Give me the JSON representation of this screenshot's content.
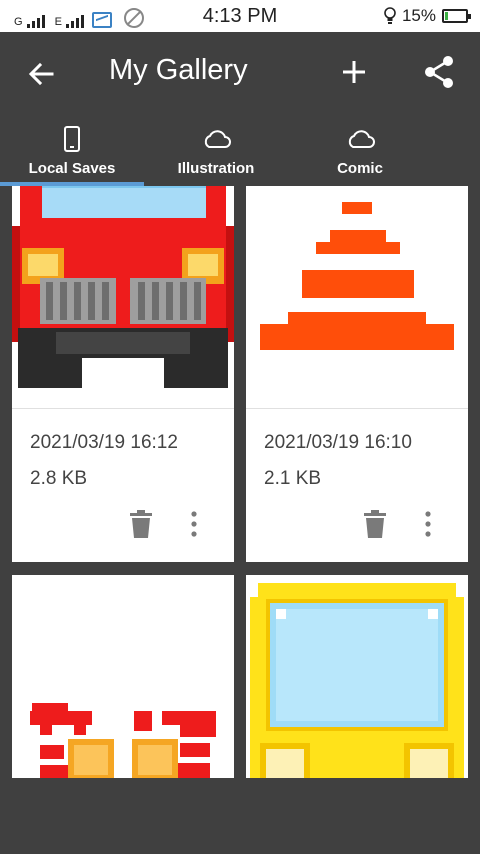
{
  "status_bar": {
    "carrier1": "G",
    "carrier2": "E",
    "time": "4:13 PM",
    "battery": "15%",
    "battery_level": 0.15,
    "icons": [
      "signal-icon",
      "signal-icon",
      "gallery-status-icon",
      "rotation-lock-icon",
      "bulb-icon",
      "battery-icon"
    ]
  },
  "appbar": {
    "title": "My Gallery",
    "icons": [
      "back-arrow-icon",
      "add-icon",
      "share-icon"
    ]
  },
  "tabs": [
    {
      "label": "Local Saves",
      "icon": "phone-icon",
      "selected": true
    },
    {
      "label": "Illustration",
      "icon": "cloud-icon",
      "selected": false
    },
    {
      "label": "Comic",
      "icon": "cloud-icon",
      "selected": false
    }
  ],
  "gallery": {
    "items": [
      {
        "date": "2021/03/19 16:12",
        "size": "2.8 KB",
        "image": "red-truck-pixel-art"
      },
      {
        "date": "2021/03/19 16:10",
        "size": "2.1 KB",
        "image": "orange-cone-pixel-art"
      },
      {
        "image": "red-pixel-art"
      },
      {
        "image": "yellow-pixel-art"
      }
    ]
  },
  "colors": {
    "bar": "#404040",
    "accent": "#5b9bd5",
    "white": "#ffffff"
  }
}
